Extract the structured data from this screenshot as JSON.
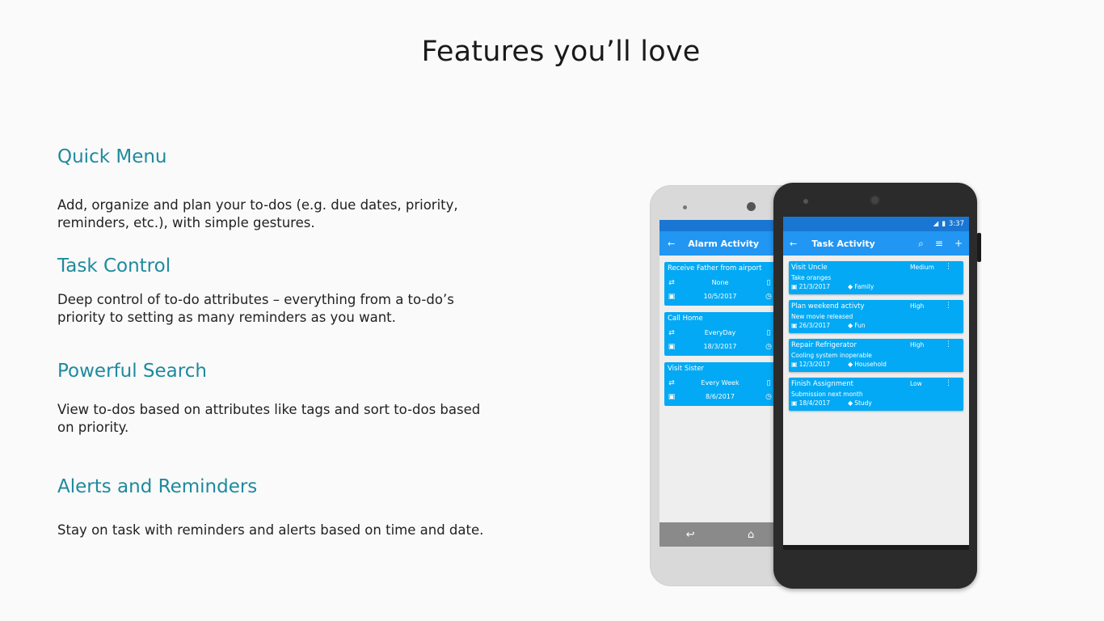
{
  "page": {
    "title": "Features you’ll love"
  },
  "features": [
    {
      "title": "Quick Menu",
      "desc": "Add, organize and plan your to-dos (e.g. due dates, priority, reminders, etc.), with simple gestures."
    },
    {
      "title": "Task Control",
      "desc": "Deep control of to-do attributes – everything from a to-do’s priority to setting as many reminders as you want."
    },
    {
      "title": "Powerful Search",
      "desc": "View to-dos based on attributes like tags and sort to-dos based on priority."
    },
    {
      "title": "Alerts and Reminders",
      "desc": "Stay on task with reminders and alerts based on time and date."
    }
  ],
  "back_phone": {
    "appbar_title": "Alarm Activity",
    "alarms": [
      {
        "name": "Receive Father from airport",
        "repeat": "None",
        "date": "10/5/2017"
      },
      {
        "name": "Call Home",
        "repeat": "EveryDay",
        "date": "18/3/2017"
      },
      {
        "name": "Visit Sister",
        "repeat": "Every Week",
        "date": "8/6/2017"
      }
    ]
  },
  "front_phone": {
    "status_time": "3:37",
    "appbar_title": "Task Activity",
    "tasks": [
      {
        "title": "Visit Uncle",
        "priority": "Medium",
        "note": "Take oranges",
        "date": "21/3/2017",
        "tag": "Family"
      },
      {
        "title": "Plan weekend activty",
        "priority": "High",
        "note": "New movie released",
        "date": "26/3/2017",
        "tag": "Fun"
      },
      {
        "title": "Repair Refrigerator",
        "priority": "High",
        "note": "Cooling system inoperable",
        "date": "12/3/2017",
        "tag": "Household"
      },
      {
        "title": "Finish Assignment",
        "priority": "Low",
        "note": "Submission next month",
        "date": "18/4/2017",
        "tag": "Study"
      }
    ]
  },
  "colors": {
    "heading": "#1e8a9e",
    "appbar": "#2196f3",
    "statusbar": "#1976d2",
    "card": "#03a9f4"
  }
}
